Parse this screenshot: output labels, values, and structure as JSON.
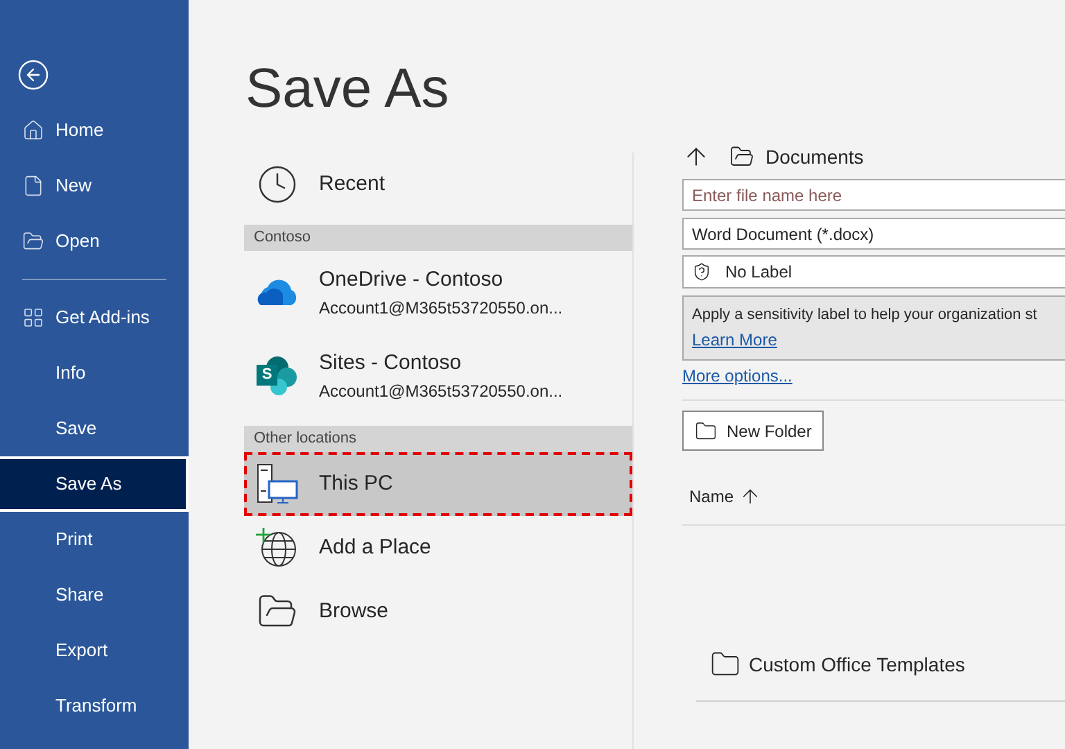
{
  "sidebar": {
    "sections": [
      {
        "items": [
          {
            "label": "Home",
            "selected": false
          },
          {
            "label": "New",
            "selected": false
          },
          {
            "label": "Open",
            "selected": false
          }
        ]
      },
      {
        "items": [
          {
            "label": "Get Add-ins",
            "selected": false
          },
          {
            "label": "Info",
            "selected": false
          },
          {
            "label": "Save",
            "selected": false
          },
          {
            "label": "Save As",
            "selected": true
          },
          {
            "label": "Print",
            "selected": false
          },
          {
            "label": "Share",
            "selected": false
          },
          {
            "label": "Export",
            "selected": false
          },
          {
            "label": "Transform",
            "selected": false
          }
        ]
      }
    ]
  },
  "page_title": "Save As",
  "locations": [
    {
      "kind": "recent",
      "label": "Recent",
      "selected": false
    },
    {
      "kind": "header",
      "label": "Contoso"
    },
    {
      "kind": "onedrive",
      "label": "OneDrive - Contoso",
      "subtitle": "Account1@M365t53720550.on...",
      "selected": false
    },
    {
      "kind": "sharepoint",
      "label": "Sites - Contoso",
      "subtitle": "Account1@M365t53720550.on...",
      "logo_letter": "S",
      "selected": false
    },
    {
      "kind": "header",
      "label": "Other locations"
    },
    {
      "kind": "pc",
      "label": "This PC",
      "selected": true
    },
    {
      "kind": "add_place",
      "label": "Add a Place",
      "selected": false
    },
    {
      "kind": "browse",
      "label": "Browse",
      "selected": false
    }
  ],
  "save_panel": {
    "path": "Documents",
    "filename_placeholder": "Enter file name here",
    "file_type": "Word Document (*.docx)",
    "sensitivity_label": "No Label",
    "sensitivity_info": "Apply a sensitivity label to help your organization st",
    "learn_more": "Learn More",
    "more_options": "More options...",
    "new_folder": "New Folder",
    "column": "Name",
    "files": [
      {
        "name": "Custom Office Templates"
      }
    ]
  }
}
